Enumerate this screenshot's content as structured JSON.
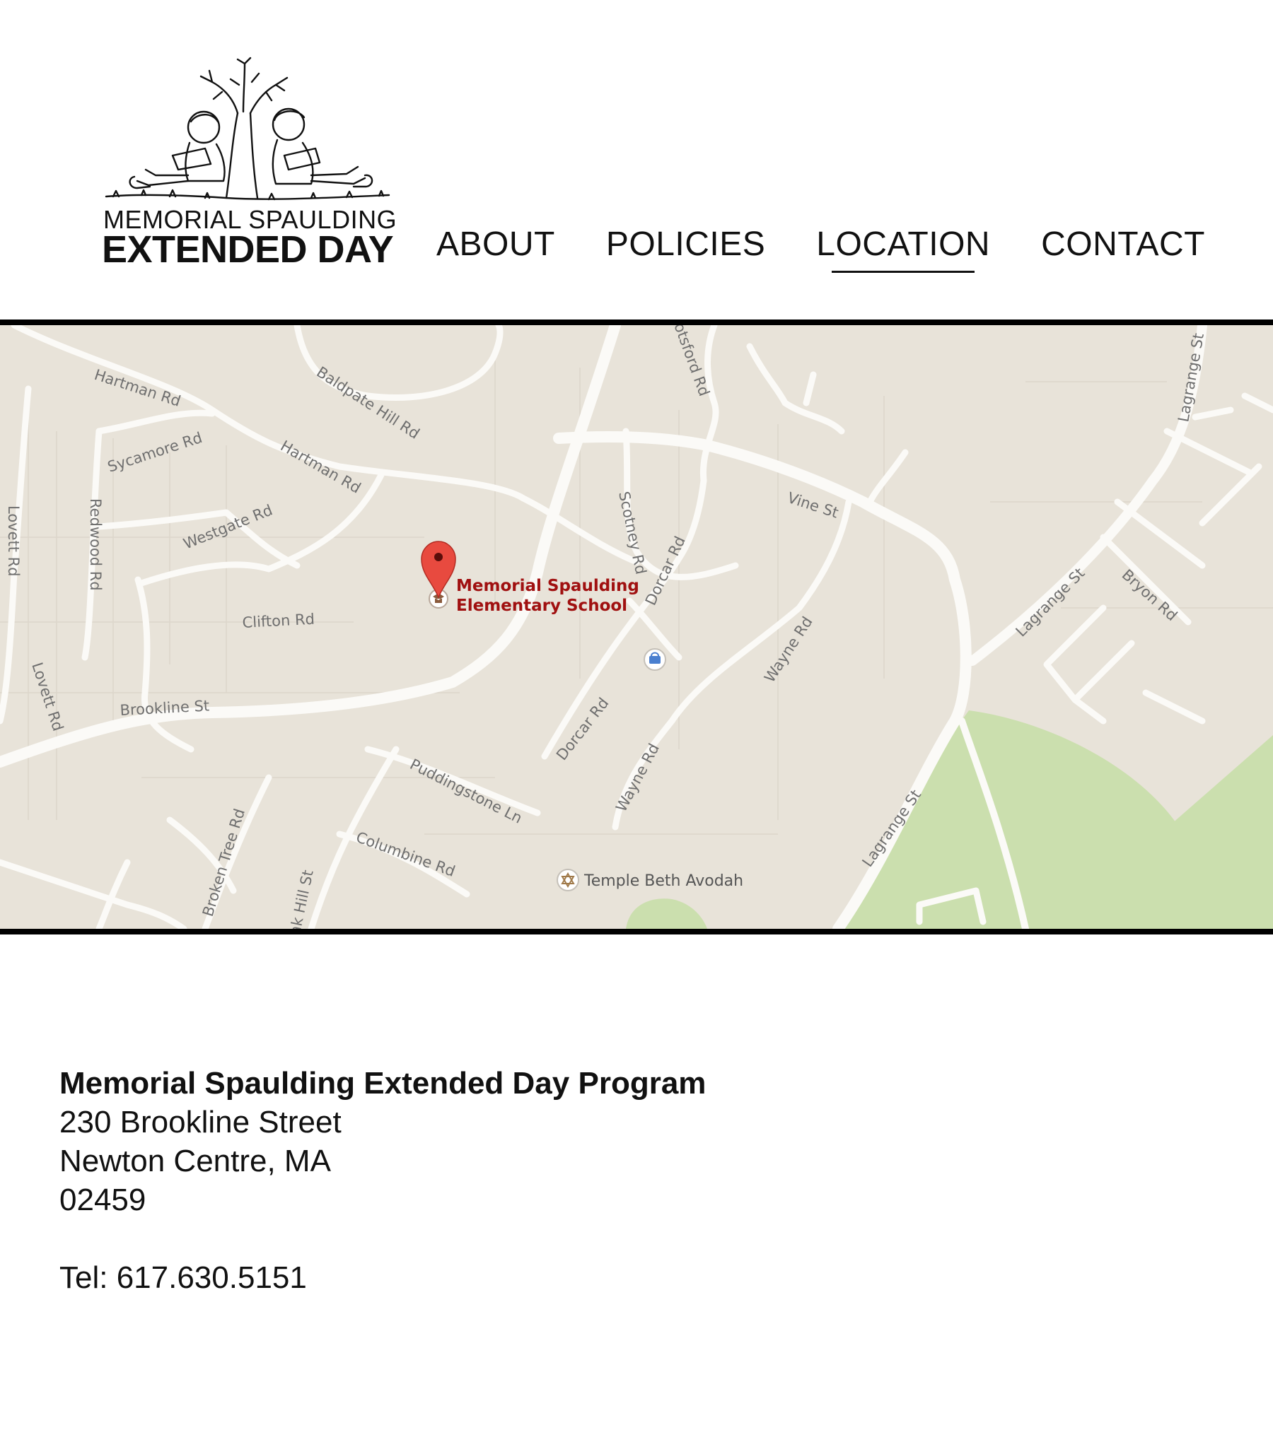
{
  "logo": {
    "line1": "MEMORIAL SPAULDING",
    "line2": "EXTENDED DAY"
  },
  "nav": {
    "items": [
      {
        "label": "ABOUT",
        "active": false
      },
      {
        "label": "POLICIES",
        "active": false
      },
      {
        "label": "LOCATION",
        "active": true
      },
      {
        "label": "CONTACT",
        "active": false
      }
    ]
  },
  "map": {
    "marker_label_line1": "Memorial Spaulding",
    "marker_label_line2": "Elementary School",
    "poi_temple": "Temple Beth Avodah",
    "roads": {
      "hartman_1": "Hartman Rd",
      "hartman_2": "Hartman Rd",
      "baldpate": "Baldpate Hill Rd",
      "sycamore": "Sycamore Rd",
      "westgate": "Westgate Rd",
      "clifton": "Clifton Rd",
      "brookline": "Brookline St",
      "lovett_1": "Lovett Rd",
      "lovett_2": "Lovett Rd",
      "redwood": "Redwood Rd",
      "abbotsford": "otsford Rd",
      "vine": "Vine St",
      "scotney": "Scotney Rd",
      "dorcar_1": "Dorcar Rd",
      "dorcar_2": "Dorcar Rd",
      "wayne_1": "Wayne Rd",
      "wayne_2": "Wayne Rd",
      "puddingstone": "Puddingstone Ln",
      "columbine": "Columbine Rd",
      "broken_tree": "Broken Tree Rd",
      "oak_hill": "Oak Hill St",
      "lagrange_1": "Lagrange St",
      "lagrange_2": "Lagrange St",
      "lagrange_3": "Lagrange St",
      "bryon": "Bryon Rd"
    },
    "colors": {
      "land": "#e8e3d9",
      "road": "#fbfaf7",
      "park": "#cbdfae",
      "marker": "#e84a3f"
    }
  },
  "address": {
    "name": "Memorial Spaulding Extended Day Program",
    "street": "230 Brookline Street",
    "city": "Newton Centre, MA",
    "zip": "02459",
    "phone": "Tel: 617.630.5151"
  }
}
